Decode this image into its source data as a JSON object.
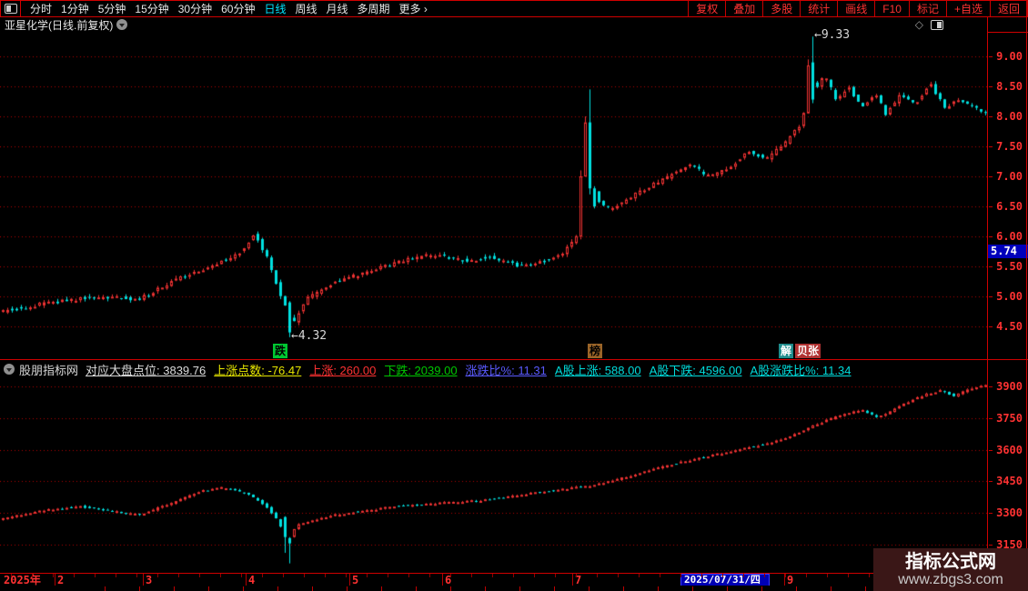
{
  "toolbar": {
    "periods": [
      "分时",
      "1分钟",
      "5分钟",
      "15分钟",
      "30分钟",
      "60分钟",
      "日线",
      "周线",
      "月线",
      "多周期",
      "更多 ›"
    ],
    "active_period": "日线",
    "right_buttons": [
      "复权",
      "叠加",
      "多股",
      "统计",
      "画线",
      "F10",
      "标记",
      "+自选",
      "返回"
    ]
  },
  "titlebar": {
    "title": "亚星化学(日线.前复权)"
  },
  "indicator_header": {
    "site": "股朋指标网",
    "metrics": [
      {
        "label": "对应大盘点位",
        "value": "3839.76",
        "color": "#dcdcdc"
      },
      {
        "label": "上涨点数",
        "value": "-76.47",
        "color": "#e6e600"
      },
      {
        "label": "上涨",
        "value": "260.00",
        "color": "#ff3232"
      },
      {
        "label": "下跌",
        "value": "2039.00",
        "color": "#00c800"
      },
      {
        "label": "涨跌比%",
        "value": "11.31",
        "color": "#5a5aff"
      },
      {
        "label": "A股上涨",
        "value": "588.00",
        "color": "#00dcdc"
      },
      {
        "label": "A股下跌",
        "value": "4596.00",
        "color": "#00dcdc"
      },
      {
        "label": "A股涨跌比%",
        "value": "11.34",
        "color": "#00dcdc"
      }
    ]
  },
  "price_tag": "5.74",
  "x_axis": {
    "year": {
      "label": "2025年",
      "x": 4
    },
    "months": [
      {
        "label": "2",
        "x": 63
      },
      {
        "label": "3",
        "x": 160
      },
      {
        "label": "4",
        "x": 273
      },
      {
        "label": "5",
        "x": 387
      },
      {
        "label": "6",
        "x": 489
      },
      {
        "label": "7",
        "x": 632
      },
      {
        "label": "9",
        "x": 865
      }
    ],
    "date_tag": {
      "label": "2025/07/31/四",
      "x": 748,
      "width": 90
    }
  },
  "markers": [
    {
      "text": "跌",
      "x": 300,
      "bg": "#00c832",
      "fg": "#000000"
    },
    {
      "text": "榜",
      "x": 646,
      "bg": "#9a6428",
      "fg": "#000000"
    },
    {
      "text": "解",
      "x": 856,
      "bg": "#1f8c8c",
      "fg": "#ffffff"
    },
    {
      "text": "贝张",
      "x": 874,
      "bg": "#b03232",
      "fg": "#ffffff"
    }
  ],
  "annotations": [
    {
      "text": "←9.33",
      "f": 0.8241,
      "price": 9.33,
      "chart": 0
    },
    {
      "text": "←4.32",
      "f": 0.2917,
      "price": 4.32,
      "chart": 0
    }
  ],
  "watermark": {
    "line1": "指标公式网",
    "line2": "www.zbgs3.com"
  },
  "colors": {
    "border": "#d00000",
    "grid": "#b40000",
    "candle_up": "#ee3232",
    "candle_down": "#00e0e0",
    "axis_text": "#ff3232",
    "tag_blue": "#0000bb",
    "active_period": "#00e5ff"
  },
  "chart_data": [
    {
      "type": "candlestick",
      "title": "亚星化学 日线 前复权",
      "ylim": [
        4.03,
        9.41
      ],
      "y_ticks": [
        9.0,
        8.5,
        8.0,
        7.5,
        7.0,
        6.5,
        6.0,
        5.5,
        5.0,
        4.5
      ],
      "grid": "horizontal-dotted",
      "keyframes": [
        [
          0.0,
          4.75
        ],
        [
          0.05,
          4.9
        ],
        [
          0.1,
          5.0
        ],
        [
          0.14,
          4.95
        ],
        [
          0.18,
          5.3
        ],
        [
          0.22,
          5.55
        ],
        [
          0.245,
          5.75
        ],
        [
          0.258,
          6.05
        ],
        [
          0.272,
          5.6
        ],
        [
          0.283,
          5.05
        ],
        [
          0.297,
          4.55
        ],
        [
          0.31,
          4.95
        ],
        [
          0.34,
          5.25
        ],
        [
          0.38,
          5.45
        ],
        [
          0.41,
          5.6
        ],
        [
          0.44,
          5.7
        ],
        [
          0.47,
          5.6
        ],
        [
          0.5,
          5.65
        ],
        [
          0.53,
          5.5
        ],
        [
          0.555,
          5.6
        ],
        [
          0.572,
          5.7
        ],
        [
          0.582,
          5.95
        ],
        [
          0.588,
          6.0
        ],
        [
          0.597,
          7.2
        ],
        [
          0.606,
          6.6
        ],
        [
          0.62,
          6.45
        ],
        [
          0.65,
          6.75
        ],
        [
          0.68,
          7.0
        ],
        [
          0.7,
          7.2
        ],
        [
          0.72,
          7.0
        ],
        [
          0.74,
          7.15
        ],
        [
          0.76,
          7.4
        ],
        [
          0.78,
          7.3
        ],
        [
          0.8,
          7.6
        ],
        [
          0.815,
          7.9
        ],
        [
          0.823,
          8.6
        ],
        [
          0.83,
          8.45
        ],
        [
          0.838,
          8.7
        ],
        [
          0.85,
          8.25
        ],
        [
          0.862,
          8.5
        ],
        [
          0.875,
          8.15
        ],
        [
          0.89,
          8.4
        ],
        [
          0.9,
          8.05
        ],
        [
          0.915,
          8.35
        ],
        [
          0.93,
          8.2
        ],
        [
          0.945,
          8.55
        ],
        [
          0.96,
          8.15
        ],
        [
          0.975,
          8.3
        ],
        [
          0.99,
          8.15
        ],
        [
          1.0,
          8.05
        ]
      ],
      "specials": [
        {
          "f": 0.2917,
          "open": 4.9,
          "close": 4.4,
          "low": 4.32
        },
        {
          "f": 0.588,
          "open": 6.0,
          "close": 7.0,
          "high": 7.1,
          "low": 5.95
        },
        {
          "f": 0.5926,
          "open": 7.0,
          "close": 7.9,
          "high": 8.0
        },
        {
          "f": 0.5972,
          "open": 7.9,
          "close": 6.8,
          "high": 8.45,
          "low": 6.7
        },
        {
          "f": 0.6019,
          "open": 6.8,
          "close": 6.5
        },
        {
          "f": 0.8195,
          "open": 8.05,
          "close": 8.85,
          "high": 8.95
        },
        {
          "f": 0.8241,
          "open": 8.9,
          "close": 8.28,
          "high": 9.33,
          "low": 8.22
        }
      ],
      "noise": 0.06,
      "wick": 0.05,
      "seed": 5
    },
    {
      "type": "candlestick",
      "title": "对应大盘指数",
      "ylim": [
        3030,
        3975
      ],
      "y_ticks": [
        3900,
        3750,
        3600,
        3450,
        3300,
        3150
      ],
      "grid": "horizontal-dotted",
      "keyframes": [
        [
          0,
          3270
        ],
        [
          0.04,
          3310
        ],
        [
          0.08,
          3330
        ],
        [
          0.11,
          3310
        ],
        [
          0.14,
          3290
        ],
        [
          0.17,
          3340
        ],
        [
          0.2,
          3400
        ],
        [
          0.225,
          3420
        ],
        [
          0.25,
          3390
        ],
        [
          0.27,
          3330
        ],
        [
          0.283,
          3250
        ],
        [
          0.2917,
          3170
        ],
        [
          0.3,
          3240
        ],
        [
          0.32,
          3270
        ],
        [
          0.34,
          3290
        ],
        [
          0.37,
          3310
        ],
        [
          0.4,
          3330
        ],
        [
          0.43,
          3340
        ],
        [
          0.46,
          3350
        ],
        [
          0.49,
          3360
        ],
        [
          0.52,
          3380
        ],
        [
          0.55,
          3400
        ],
        [
          0.575,
          3415
        ],
        [
          0.6,
          3430
        ],
        [
          0.625,
          3455
        ],
        [
          0.65,
          3490
        ],
        [
          0.675,
          3520
        ],
        [
          0.7,
          3550
        ],
        [
          0.72,
          3570
        ],
        [
          0.74,
          3590
        ],
        [
          0.76,
          3610
        ],
        [
          0.78,
          3630
        ],
        [
          0.8,
          3660
        ],
        [
          0.82,
          3700
        ],
        [
          0.84,
          3740
        ],
        [
          0.86,
          3770
        ],
        [
          0.875,
          3790
        ],
        [
          0.89,
          3755
        ],
        [
          0.9,
          3770
        ],
        [
          0.92,
          3820
        ],
        [
          0.94,
          3860
        ],
        [
          0.955,
          3880
        ],
        [
          0.97,
          3855
        ],
        [
          0.985,
          3890
        ],
        [
          1.0,
          3905
        ]
      ],
      "specials": [
        {
          "f": 0.287,
          "open": 3280,
          "close": 3185,
          "low": 3110
        },
        {
          "f": 0.2917,
          "open": 3180,
          "close": 3155,
          "low": 3060
        }
      ],
      "noise": 8,
      "wick": 6,
      "seed": 9
    }
  ]
}
